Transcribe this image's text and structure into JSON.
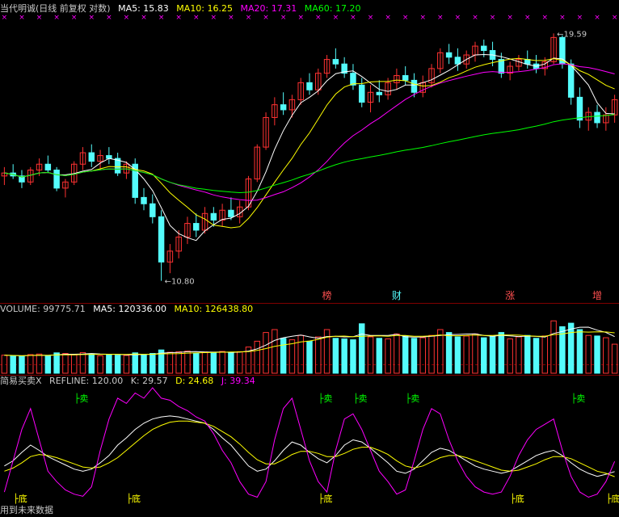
{
  "colors": {
    "bg": "#000000",
    "grid": "#7f0000",
    "up": "#ff3232",
    "down": "#54fcfc",
    "ma5": "#ffffff",
    "ma10": "#ffff00",
    "ma20": "#ff00ff",
    "ma60": "#00ff00",
    "label": "#c8c8c8",
    "sell": "#00ff00",
    "bottom": "#ffff00",
    "k": "#ffffff",
    "d": "#ffff00",
    "j": "#ff00ff",
    "marker": "#ff00ff"
  },
  "main_header": {
    "title": "当代明诚(日线 前复权 对数)",
    "ma5": "MA5: 15.83",
    "ma10": "MA10: 16.25",
    "ma20": "MA20: 17.31",
    "ma60": "MA60: 17.20"
  },
  "volume_header": {
    "volume": "VOLUME: 99775.71",
    "ma5": "MA5: 120336.00",
    "ma10": "MA10: 126438.80"
  },
  "indicator_header": {
    "name": "简易买卖X",
    "refline": "REFLINE: 120.00",
    "k": "K: 29.57",
    "d": "D: 24.68",
    "j": "J: 39.34"
  },
  "footer": {
    "text": "用到未来数据"
  },
  "chart_data": [
    {
      "type": "candlestick",
      "price_range": [
        10.3,
        20.5
      ],
      "scale": "log",
      "candles": [
        [
          13.9,
          14.2,
          13.6,
          14.0
        ],
        [
          14.0,
          14.3,
          13.8,
          13.9
        ],
        [
          13.9,
          14.1,
          13.5,
          13.7
        ],
        [
          13.7,
          14.2,
          13.6,
          14.1
        ],
        [
          14.1,
          14.5,
          13.9,
          14.3
        ],
        [
          14.3,
          14.6,
          14.0,
          14.1
        ],
        [
          14.1,
          14.2,
          13.4,
          13.5
        ],
        [
          13.5,
          13.8,
          13.2,
          13.7
        ],
        [
          13.7,
          14.4,
          13.6,
          14.3
        ],
        [
          14.3,
          14.9,
          14.1,
          14.7
        ],
        [
          14.7,
          15.0,
          14.2,
          14.4
        ],
        [
          14.4,
          14.8,
          14.1,
          14.6
        ],
        [
          14.6,
          14.9,
          14.3,
          14.5
        ],
        [
          14.5,
          14.7,
          13.9,
          14.0
        ],
        [
          14.0,
          14.4,
          13.8,
          14.3
        ],
        [
          14.3,
          14.5,
          13.0,
          13.2
        ],
        [
          13.2,
          13.5,
          12.8,
          13.0
        ],
        [
          13.0,
          13.3,
          12.4,
          12.6
        ],
        [
          12.6,
          12.8,
          10.8,
          11.3
        ],
        [
          11.3,
          11.8,
          11.0,
          11.6
        ],
        [
          11.6,
          12.2,
          11.4,
          12.0
        ],
        [
          12.0,
          12.6,
          11.8,
          12.4
        ],
        [
          12.4,
          12.7,
          12.0,
          12.2
        ],
        [
          12.2,
          12.9,
          12.1,
          12.7
        ],
        [
          12.7,
          12.9,
          12.3,
          12.5
        ],
        [
          12.5,
          13.0,
          12.3,
          12.8
        ],
        [
          12.8,
          13.2,
          12.5,
          12.6
        ],
        [
          12.6,
          13.1,
          12.4,
          12.9
        ],
        [
          12.9,
          13.9,
          12.8,
          13.8
        ],
        [
          13.8,
          15.0,
          13.7,
          14.9
        ],
        [
          14.9,
          16.2,
          14.8,
          16.0
        ],
        [
          16.0,
          16.8,
          15.7,
          16.5
        ],
        [
          16.5,
          17.0,
          16.1,
          16.3
        ],
        [
          16.3,
          16.9,
          16.0,
          16.7
        ],
        [
          16.7,
          17.6,
          16.5,
          17.4
        ],
        [
          17.4,
          17.8,
          16.9,
          17.1
        ],
        [
          17.1,
          18.0,
          16.9,
          17.8
        ],
        [
          17.8,
          18.6,
          17.6,
          18.4
        ],
        [
          18.4,
          18.9,
          18.0,
          18.2
        ],
        [
          18.2,
          18.5,
          17.6,
          17.8
        ],
        [
          17.8,
          18.2,
          17.1,
          17.3
        ],
        [
          17.3,
          17.6,
          16.4,
          16.6
        ],
        [
          16.6,
          17.3,
          16.2,
          17.0
        ],
        [
          17.0,
          17.5,
          16.6,
          16.9
        ],
        [
          16.9,
          17.6,
          16.7,
          17.4
        ],
        [
          17.4,
          18.0,
          17.1,
          17.7
        ],
        [
          17.7,
          18.1,
          17.3,
          17.5
        ],
        [
          17.5,
          17.8,
          16.8,
          17.0
        ],
        [
          17.0,
          17.7,
          16.8,
          17.4
        ],
        [
          17.4,
          18.2,
          17.2,
          18.0
        ],
        [
          18.0,
          18.9,
          17.8,
          18.7
        ],
        [
          18.7,
          19.1,
          18.2,
          18.5
        ],
        [
          18.5,
          18.9,
          17.9,
          18.2
        ],
        [
          18.2,
          18.8,
          18.0,
          18.6
        ],
        [
          18.6,
          19.2,
          18.3,
          19.0
        ],
        [
          19.0,
          19.3,
          18.5,
          18.8
        ],
        [
          18.8,
          19.2,
          18.1,
          18.4
        ],
        [
          18.4,
          18.7,
          17.6,
          17.8
        ],
        [
          17.8,
          18.3,
          17.5,
          18.1
        ],
        [
          18.1,
          18.6,
          17.9,
          18.4
        ],
        [
          18.4,
          18.8,
          18.0,
          18.2
        ],
        [
          18.2,
          18.6,
          17.8,
          18.0
        ],
        [
          18.0,
          18.5,
          17.7,
          18.3
        ],
        [
          18.3,
          19.59,
          18.2,
          19.4
        ],
        [
          19.4,
          19.5,
          18.0,
          18.2
        ],
        [
          18.2,
          18.4,
          16.5,
          16.8
        ],
        [
          16.8,
          17.2,
          15.6,
          15.9
        ],
        [
          15.9,
          16.4,
          15.5,
          16.2
        ],
        [
          16.2,
          16.5,
          15.6,
          15.8
        ],
        [
          15.8,
          16.4,
          15.5,
          16.1
        ],
        [
          16.1,
          16.9,
          15.8,
          16.7
        ]
      ],
      "ma_windows": [
        5,
        10,
        20,
        60
      ],
      "annotations": {
        "high": "19.59",
        "low": "10.80",
        "markers": [
          "榜",
          "财",
          "涨",
          "增"
        ]
      }
    },
    {
      "type": "bar",
      "title": "VOLUME",
      "values": [
        62000,
        60000,
        58000,
        64000,
        66000,
        59000,
        70000,
        68000,
        63000,
        71000,
        67000,
        60000,
        65000,
        62000,
        61000,
        70000,
        64000,
        68000,
        80000,
        72000,
        74000,
        76000,
        69000,
        73000,
        71000,
        75000,
        70000,
        74000,
        90000,
        110000,
        140000,
        150000,
        120000,
        115000,
        130000,
        110000,
        125000,
        150000,
        120000,
        118000,
        115000,
        170000,
        125000,
        120000,
        118000,
        135000,
        128000,
        120000,
        122000,
        130000,
        150000,
        140000,
        125000,
        128000,
        135000,
        122000,
        126000,
        140000,
        118000,
        125000,
        130000,
        120000,
        128000,
        180000,
        160000,
        172000,
        150000,
        130000,
        128000,
        122000,
        99775
      ],
      "ylim": [
        0,
        200000
      ]
    },
    {
      "type": "line",
      "title": "简易买卖X",
      "series": [
        {
          "name": "K",
          "values": [
            35,
            40,
            48,
            55,
            50,
            44,
            40,
            36,
            32,
            30,
            32,
            38,
            45,
            55,
            62,
            70,
            76,
            80,
            82,
            83,
            82,
            80,
            78,
            76,
            70,
            62,
            55,
            45,
            35,
            30,
            32,
            40,
            50,
            58,
            55,
            48,
            42,
            38,
            45,
            55,
            60,
            58,
            52,
            45,
            38,
            30,
            28,
            32,
            40,
            48,
            52,
            50,
            45,
            40,
            35,
            32,
            30,
            28,
            30,
            35,
            40,
            45,
            48,
            50,
            45,
            38,
            32,
            28,
            25,
            27,
            29.57
          ]
        },
        {
          "name": "D",
          "values": [
            30,
            33,
            38,
            44,
            46,
            45,
            43,
            40,
            37,
            34,
            33,
            34,
            38,
            43,
            50,
            57,
            64,
            70,
            74,
            77,
            78,
            78,
            77,
            76,
            73,
            68,
            63,
            56,
            48,
            41,
            37,
            37,
            41,
            46,
            49,
            49,
            47,
            44,
            44,
            47,
            51,
            53,
            53,
            50,
            46,
            40,
            35,
            33,
            35,
            39,
            43,
            45,
            45,
            43,
            40,
            37,
            34,
            31,
            30,
            31,
            34,
            37,
            41,
            44,
            44,
            42,
            38,
            34,
            30,
            28,
            24.68
          ]
        },
        {
          "name": "J",
          "values": [
            10,
            40,
            70,
            90,
            60,
            30,
            20,
            12,
            8,
            6,
            15,
            50,
            80,
            100,
            95,
            105,
            100,
            110,
            100,
            98,
            92,
            88,
            82,
            78,
            66,
            50,
            38,
            20,
            8,
            5,
            20,
            60,
            90,
            100,
            70,
            40,
            20,
            10,
            50,
            80,
            85,
            70,
            50,
            30,
            20,
            8,
            12,
            40,
            70,
            90,
            85,
            60,
            40,
            25,
            15,
            10,
            8,
            10,
            25,
            45,
            60,
            70,
            75,
            80,
            50,
            25,
            10,
            5,
            8,
            20,
            39.34
          ]
        }
      ],
      "sell_label": "卖",
      "bottom_label": "底"
    }
  ]
}
